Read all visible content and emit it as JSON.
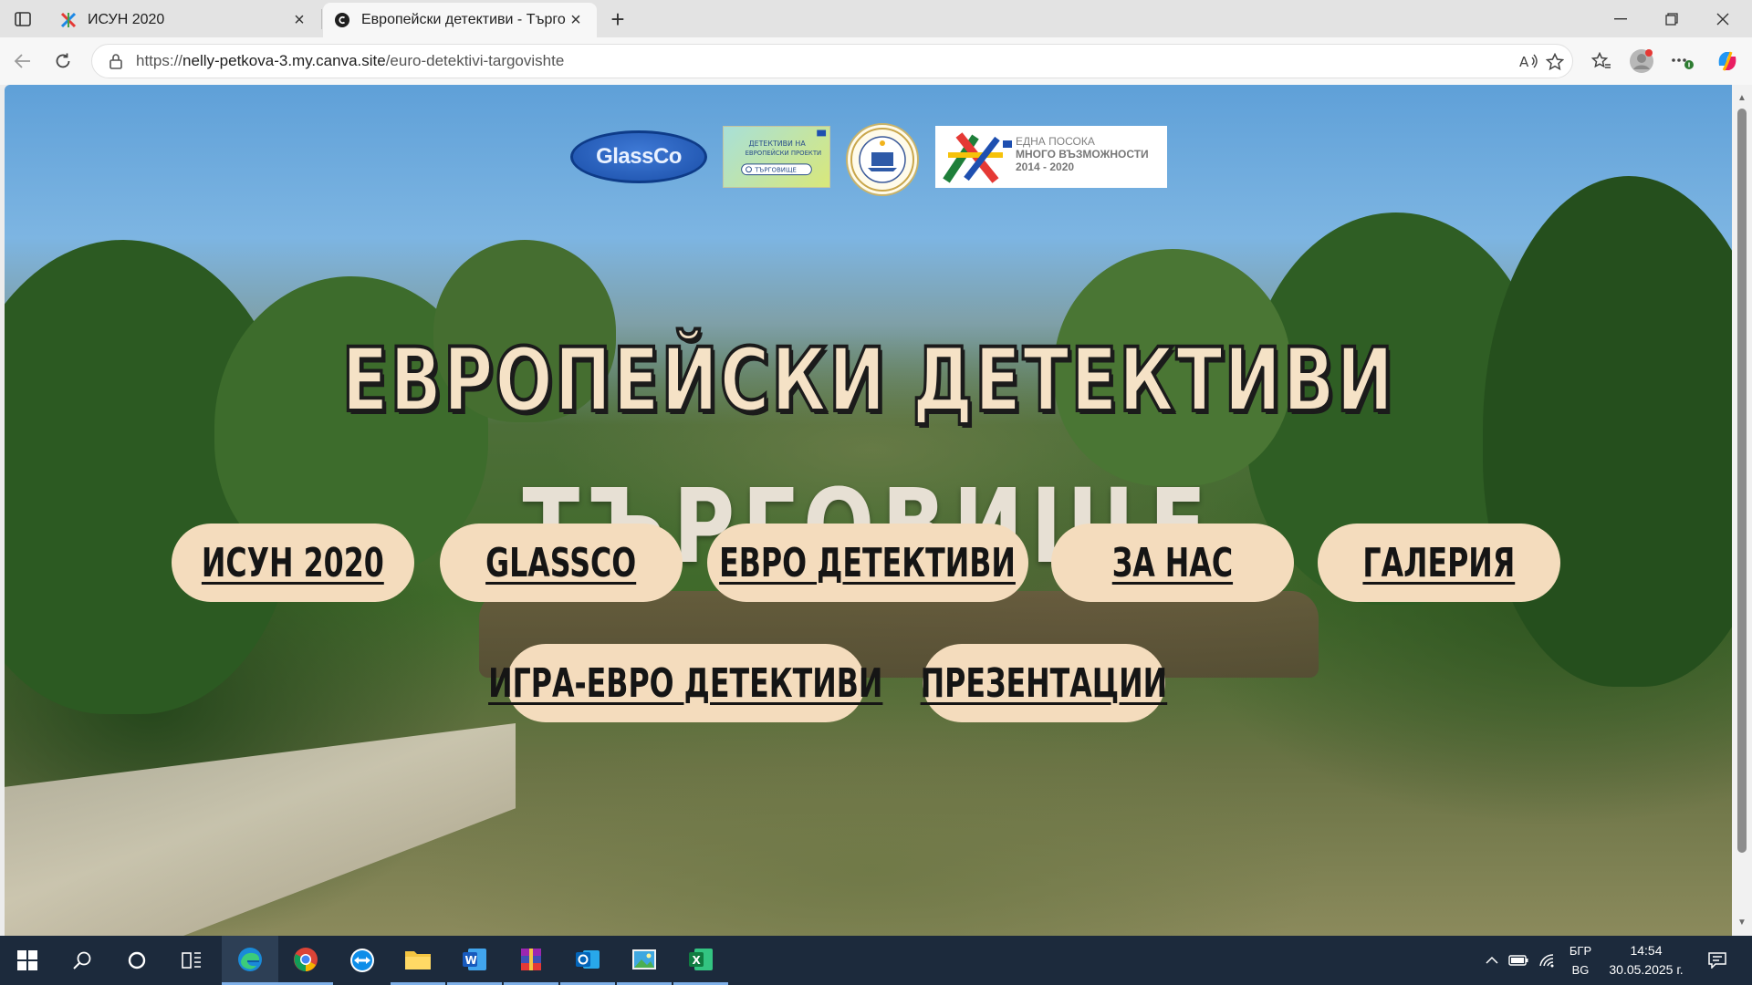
{
  "browser": {
    "tabs": [
      {
        "title": "ИСУН 2020",
        "active": false
      },
      {
        "title": "Европейски детективи - Търговище",
        "active": true
      }
    ],
    "address": {
      "protocol": "https://",
      "host": "nelly-petkova-3.my.canva.site",
      "path": "/euro-detektivi-targovishte"
    }
  },
  "page": {
    "logos": {
      "glassco": "GlassCo",
      "detectives_line1": "ДЕТЕКТИВИ НА",
      "detectives_line2": "ЕВРОПЕЙСКИ ПРОЕКТИ",
      "detectives_search": "ТЪРГОВИЩЕ",
      "eu_line1": "ЕДНА ПОСОКА",
      "eu_line2": "МНОГО ВЪЗМОЖНОСТИ",
      "eu_line3": "2014 - 2020"
    },
    "title_line1": "ЕВРОПЕЙСКИ ДЕТЕКТИВИ",
    "title_line2": "ТЪРГОВИЩЕ",
    "nav": [
      {
        "label": "ИСУН 2020"
      },
      {
        "label": "GLASSCO"
      },
      {
        "label": "ЕВРО ДЕТЕКТИВИ"
      },
      {
        "label": "ЗА НАС"
      },
      {
        "label": "ГАЛЕРИЯ"
      },
      {
        "label": "ИГРА-ЕВРО ДЕТЕКТИВИ"
      },
      {
        "label": "ПРЕЗЕНТАЦИИ"
      }
    ],
    "colors": {
      "pill_bg": "#f4dcbd",
      "title_fill": "#f5e2c6"
    }
  },
  "taskbar": {
    "apps": [
      "windows-start",
      "search",
      "cortana",
      "task-view",
      "edge",
      "chrome",
      "teamviewer",
      "file-explorer",
      "word",
      "winrar",
      "outlook",
      "photos",
      "excel"
    ],
    "input_lang_top": "БГР",
    "input_lang_bottom": "BG",
    "time": "14:54",
    "date": "30.05.2025 г."
  }
}
